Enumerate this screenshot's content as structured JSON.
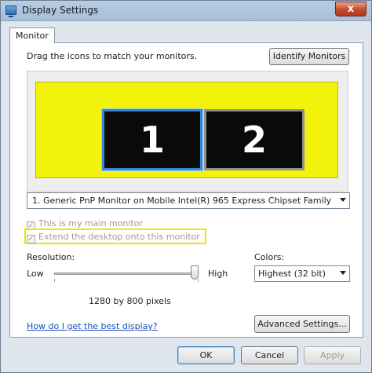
{
  "window": {
    "title": "Display Settings",
    "close_glyph": "x"
  },
  "tabs": [
    {
      "label": "Monitor"
    }
  ],
  "monitor_tab": {
    "instruction": "Drag the icons to match your monitors.",
    "identify_button": "Identify Monitors",
    "monitors": [
      {
        "number": "1",
        "selected": true
      },
      {
        "number": "2",
        "selected": false
      }
    ],
    "monitor_select": "1. Generic PnP Monitor on Mobile Intel(R) 965 Express Chipset Family",
    "main_monitor_checkbox": {
      "label": "This is my main monitor",
      "checked": true,
      "enabled": false
    },
    "extend_checkbox": {
      "label": "Extend the desktop onto this monitor",
      "checked": true,
      "enabled": false
    },
    "resolution": {
      "label": "Resolution:",
      "low": "Low",
      "high": "High",
      "value_text": "1280 by 800 pixels",
      "slider_fraction": 1.0
    },
    "colors": {
      "label": "Colors:",
      "selected": "Highest (32 bit)"
    },
    "help_link": "How do I get the best display?",
    "advanced_button": "Advanced Settings..."
  },
  "footer": {
    "ok": "OK",
    "cancel": "Cancel",
    "apply": "Apply"
  },
  "colors": {
    "highlight": "#f0e400",
    "preview_background": "#f2f20a",
    "selected_monitor_border": "#2f86d9"
  }
}
